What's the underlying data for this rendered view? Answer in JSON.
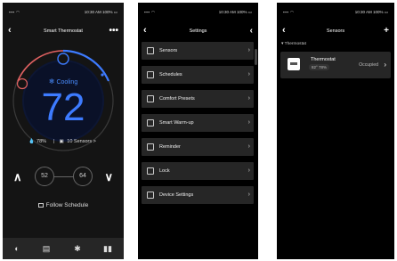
{
  "status": {
    "time": "10:30 AM",
    "battery": "100%"
  },
  "thermostat_screen": {
    "title": "Smart Thermostat",
    "menu_icon": "more-dots-icon",
    "mode": "Cooling",
    "current_temp": "72",
    "humidity": "78%",
    "sensors_link": "10 Sensors >",
    "heat_setpoint": "52",
    "cool_setpoint": "64",
    "follow_schedule": "Follow Schedule",
    "tabs": [
      "home-icon",
      "thermostat-icon",
      "gear-icon",
      "chart-icon"
    ]
  },
  "settings_screen": {
    "title": "Settings",
    "items": [
      {
        "label": "Sensors",
        "icon": "sensor-icon"
      },
      {
        "label": "Schedules",
        "icon": "schedule-icon"
      },
      {
        "label": "Comfort Presets",
        "icon": "presets-icon"
      },
      {
        "label": "Smart Warm-up",
        "icon": "thermometer-icon"
      },
      {
        "label": "Reminder",
        "icon": "reminder-icon"
      },
      {
        "label": "Lock",
        "icon": "lock-icon"
      },
      {
        "label": "Device Settings",
        "icon": "device-icon"
      }
    ]
  },
  "sensors_screen": {
    "title": "Sensors",
    "section": "Thermostat",
    "device_name": "Thermostat",
    "device_values": "82° 78%",
    "device_status": "Occupied"
  }
}
